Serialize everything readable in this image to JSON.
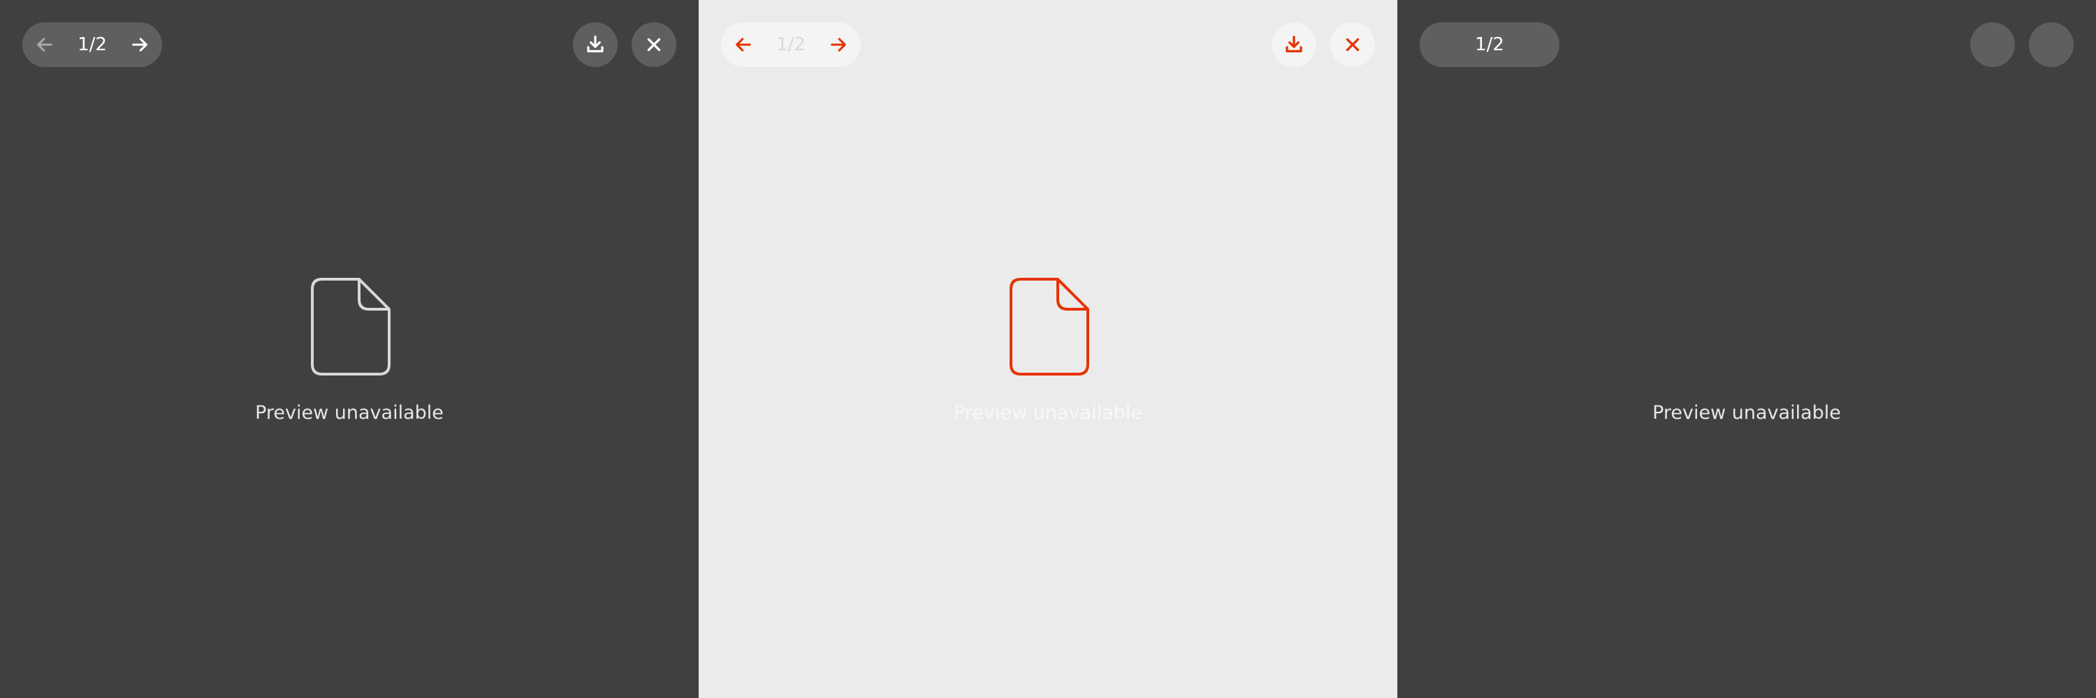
{
  "panels": [
    {
      "page_counter": "1/2",
      "message": "Preview unavailable",
      "icons": {
        "prev": "arrow-left-icon",
        "next": "arrow-right-icon",
        "download": "download-icon",
        "close": "close-icon",
        "file": "file-icon"
      },
      "colors": {
        "background": "#404040",
        "control": "#5f5f5f",
        "icon": "#ffffff",
        "icon_disabled": "#a8a8a8",
        "file": "#d9d9d9"
      }
    },
    {
      "page_counter": "1/2",
      "message": "Preview unavailable",
      "icons": {
        "prev": "arrow-left-icon",
        "next": "arrow-right-icon",
        "download": "download-icon",
        "close": "close-icon",
        "file": "file-icon"
      },
      "colors": {
        "background": "#ebebeb",
        "control": "#f4f4f4",
        "accent": "#e63300"
      }
    },
    {
      "page_counter": "1/2",
      "message": "Preview unavailable",
      "colors": {
        "background": "#404040",
        "control": "#5f5f5f"
      }
    }
  ]
}
